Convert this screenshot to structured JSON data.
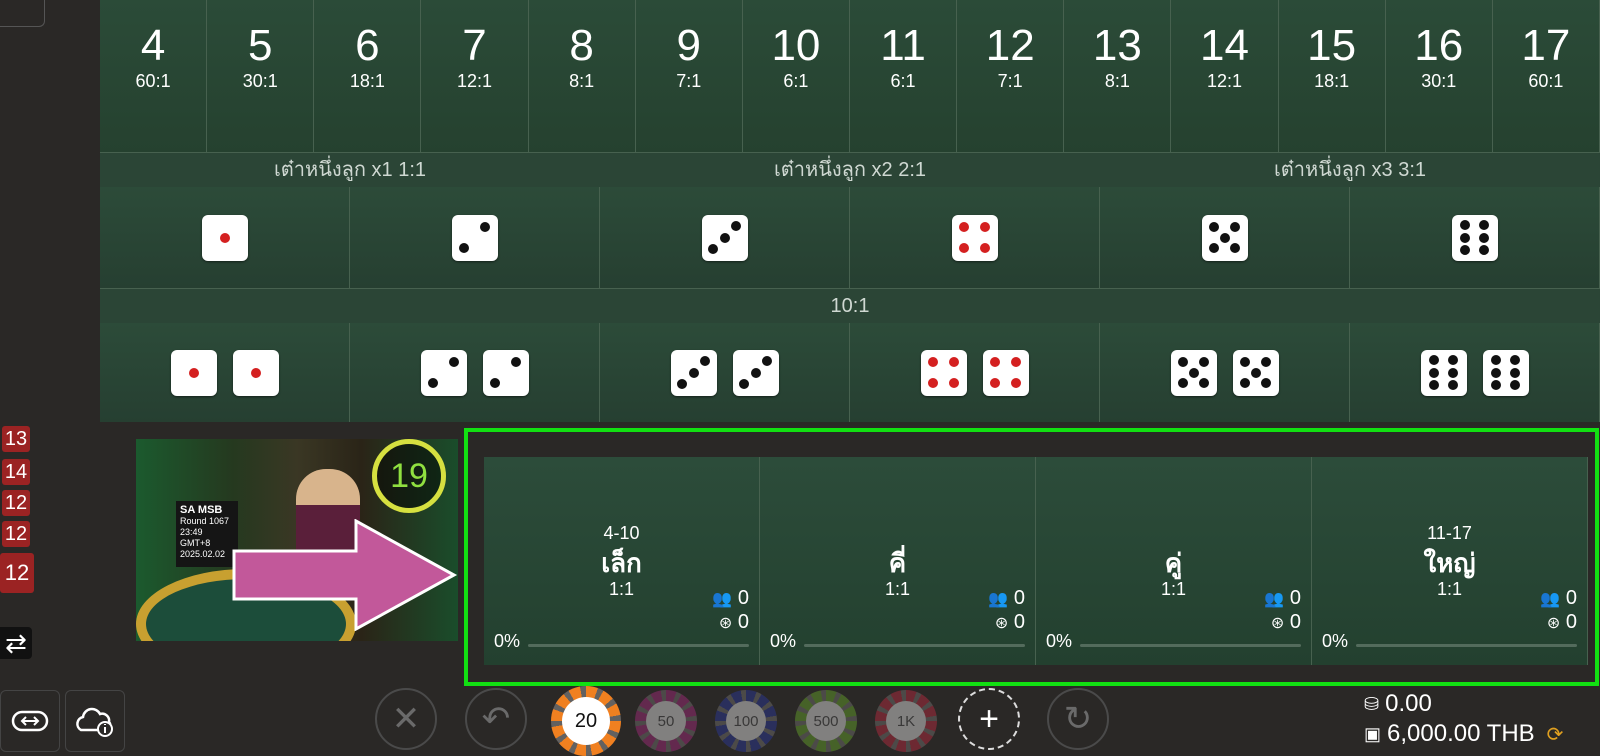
{
  "numbers": [
    {
      "n": "4",
      "odds": "60:1"
    },
    {
      "n": "5",
      "odds": "30:1"
    },
    {
      "n": "6",
      "odds": "18:1"
    },
    {
      "n": "7",
      "odds": "12:1"
    },
    {
      "n": "8",
      "odds": "8:1"
    },
    {
      "n": "9",
      "odds": "7:1"
    },
    {
      "n": "10",
      "odds": "6:1"
    },
    {
      "n": "11",
      "odds": "6:1"
    },
    {
      "n": "12",
      "odds": "7:1"
    },
    {
      "n": "13",
      "odds": "8:1"
    },
    {
      "n": "14",
      "odds": "12:1"
    },
    {
      "n": "15",
      "odds": "18:1"
    },
    {
      "n": "16",
      "odds": "30:1"
    },
    {
      "n": "17",
      "odds": "60:1"
    }
  ],
  "single_header": [
    "เต๋าหนึ่งลูก x1 1:1",
    "เต๋าหนึ่งลูก x2 2:1",
    "เต๋าหนึ่งลูก x3 3:1"
  ],
  "pair_header": "10:1",
  "dice_faces": [
    1,
    2,
    3,
    4,
    5,
    6
  ],
  "history": [
    "13",
    "14",
    "12",
    "12",
    "12"
  ],
  "video": {
    "timer": "19",
    "brand": "SA MSB",
    "round": "Round 1067",
    "time": "23:49 GMT+8",
    "date": "2025.02.02"
  },
  "bets": [
    {
      "range": "4-10",
      "name": "เล็ก",
      "odds": "1:1",
      "players": "0",
      "chips": "0",
      "pct": "0%"
    },
    {
      "range": "",
      "name": "คี่",
      "odds": "1:1",
      "players": "0",
      "chips": "0",
      "pct": "0%"
    },
    {
      "range": "",
      "name": "คู่",
      "odds": "1:1",
      "players": "0",
      "chips": "0",
      "pct": "0%"
    },
    {
      "range": "11-17",
      "name": "ใหญ่",
      "odds": "1:1",
      "players": "0",
      "chips": "0",
      "pct": "0%"
    }
  ],
  "chips": [
    {
      "label": "20",
      "color": "#f08020",
      "selected": true
    },
    {
      "label": "50",
      "color": "#8a2a6a",
      "selected": false
    },
    {
      "label": "100",
      "color": "#2a3580",
      "selected": false
    },
    {
      "label": "500",
      "color": "#5a8a2a",
      "selected": false
    },
    {
      "label": "1K",
      "color": "#9a2a3a",
      "selected": false
    }
  ],
  "controls": {
    "clear": "✕",
    "undo": "↶",
    "add": "+",
    "redo": "↻"
  },
  "balance": {
    "bet": "0.00",
    "wallet": "6,000.00 THB"
  },
  "colors": {
    "table_green": "#2c4a38",
    "highlight": "#12e012",
    "history_red": "#9b2323"
  }
}
